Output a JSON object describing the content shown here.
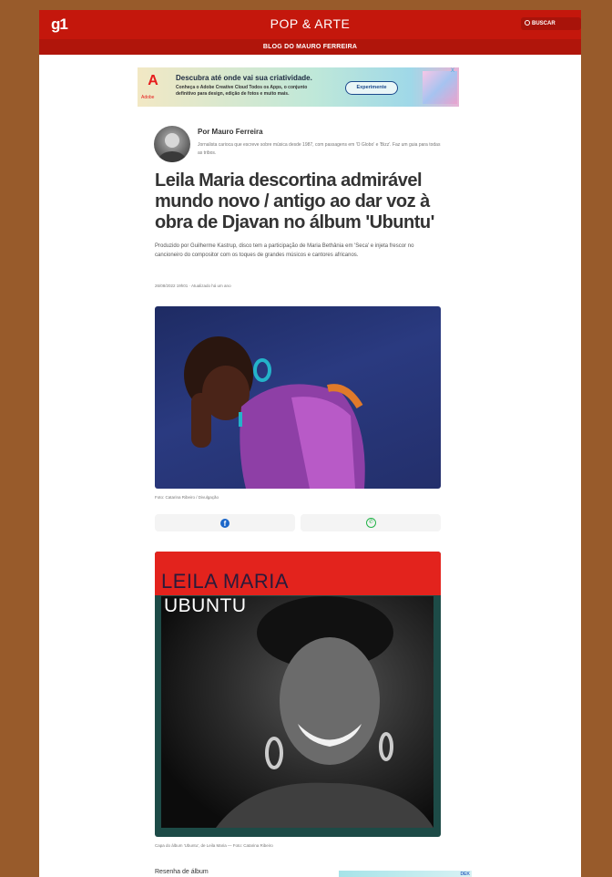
{
  "header": {
    "logo": "g1",
    "section": "POP & ARTE",
    "search_label": "BUSCAR",
    "blog_name": "BLOG DO MAURO FERREIRA",
    "brand_color": "#c4170c"
  },
  "ad": {
    "brand": "Adobe",
    "title": "Descubra até onde vai sua criatividade.",
    "text": "Conheça o Adobe Creative Cloud Todos os Apps, o conjunto definitivo para design, edição de fotos e muito mais.",
    "cta": "Experimente",
    "close": "X"
  },
  "author": {
    "name": "Por Mauro Ferreira",
    "bio": "Jornalista carioca que escreve sobre música desde 1987, com passagens em 'O Globo' e 'Bizz'. Faz um guia para todas as tribos."
  },
  "article": {
    "headline": "Leila Maria descortina admirável mundo novo / antigo ao dar voz à obra de Djavan no álbum 'Ubuntu'",
    "subtitle": "Produzido por Guilherme Kastrup, disco tem a participação de Maria Bethânia em 'Seca' e injeta frescor no cancioneiro do compositor com os toques de grandes músicos e cantores africanos.",
    "dateline": "26/08/2022 19h01 · Atualizado há um ano",
    "photo_caption": "Foto: Catarina Ribeiro / Divulgação",
    "cover_title": "LEILA MARIA",
    "cover_subtitle": "UBUNTU",
    "cover_caption": "Capa do álbum 'Ubuntu', de Leila Maria — Foto: Catarina Ribeiro",
    "review_label": "Resenha de álbum"
  },
  "share": {
    "facebook_icon": "f",
    "whatsapp_icon": "✆"
  },
  "ad2": {
    "label": "DEK"
  }
}
